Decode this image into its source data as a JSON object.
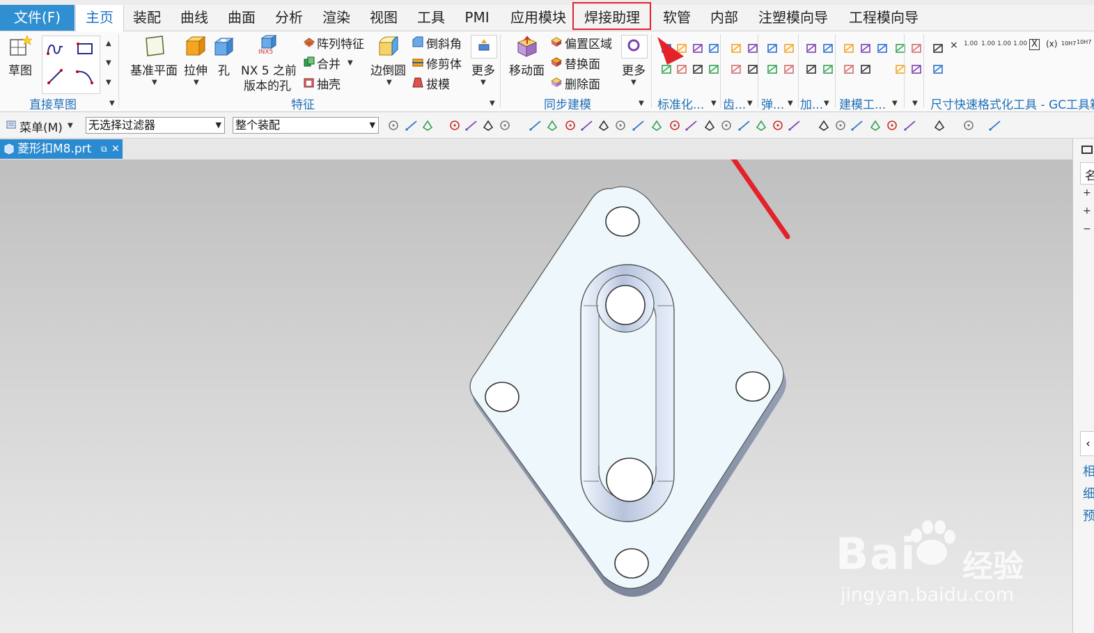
{
  "menu_tabs": [
    {
      "label": "文件(F)"
    },
    {
      "label": "主页"
    },
    {
      "label": "装配"
    },
    {
      "label": "曲线"
    },
    {
      "label": "曲面"
    },
    {
      "label": "分析"
    },
    {
      "label": "渲染"
    },
    {
      "label": "视图"
    },
    {
      "label": "工具"
    },
    {
      "label": "PMI"
    },
    {
      "label": "应用模块"
    },
    {
      "label": "焊接助理"
    },
    {
      "label": "软管"
    },
    {
      "label": "内部"
    },
    {
      "label": "注塑模向导"
    },
    {
      "label": "工程模向导"
    }
  ],
  "ribbon": {
    "sketch": {
      "draw": "草图",
      "group": "直接草图"
    },
    "feature": {
      "datum_plane": "基准平面",
      "extrude": "拉伸",
      "hole": "孔",
      "nx5_line1": "NX 5 之前",
      "nx5_line2": "版本的孔",
      "nx5_badge": "INX5",
      "pattern": "阵列特征",
      "unite": "合并",
      "shell": "抽壳",
      "edge_blend": "边倒圆",
      "chamfer": "倒斜角",
      "trim_body": "修剪体",
      "draft": "拔模",
      "more": "更多",
      "group": "特征"
    },
    "sync": {
      "move_face": "移动面",
      "offset_region": "偏置区域",
      "replace_face": "替换面",
      "delete_face": "删除面",
      "more": "更多",
      "group": "同步建模"
    },
    "groups_right": {
      "standard": "标准化...",
      "gear": "齿...",
      "spring": "弹...",
      "add": "加...",
      "modeling_tools": "建模工...",
      "dim_format": "尺寸快速格式化工具 - GC工具箱"
    },
    "dim_tools": [
      "×",
      "1.00",
      "1.00",
      "1.00",
      "1.00",
      "X",
      "(x)",
      "10H7",
      "10H7"
    ]
  },
  "toolbar": {
    "menu_label": "菜单(M)",
    "filter_value": "无选择过滤器",
    "scope_value": "整个装配"
  },
  "document": {
    "tab_label": "菱形扣M8.prt"
  },
  "right_panel": {
    "labels": [
      "名",
      "相",
      "细",
      "预"
    ]
  },
  "watermark": {
    "brand": "Bai",
    "brand_cn": "经验",
    "url": "jingyan.baidu.com"
  },
  "colors": {
    "accent": "#2f8fd0",
    "highlight": "#e3222a",
    "part_face": "#eef8fc"
  }
}
